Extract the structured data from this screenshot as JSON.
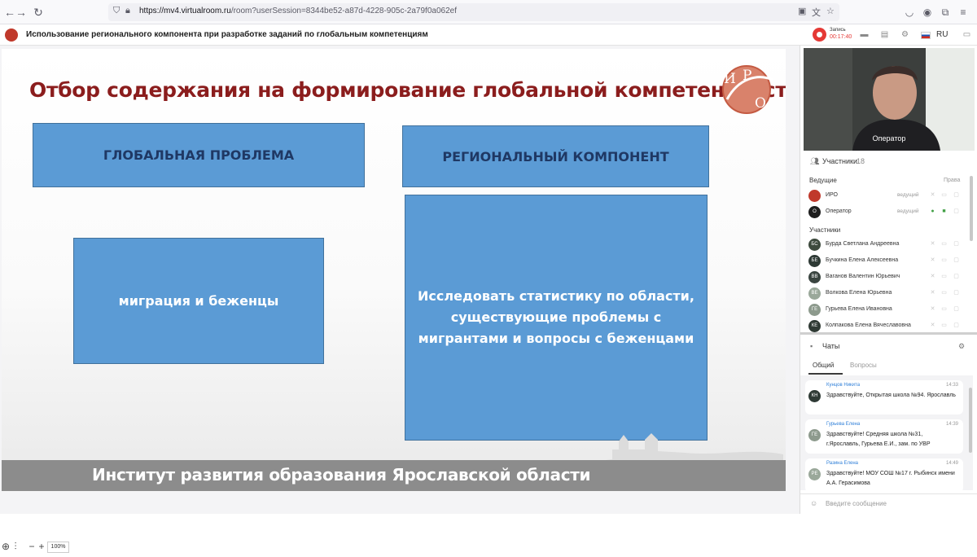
{
  "browser": {
    "url_host": "https://mv4.virtualroom.ru",
    "url_rest": "/room?userSession=8344be52-a87d-4228-905c-2a79f0a062ef",
    "back_glyph": "←",
    "forward_glyph": "→",
    "reload_glyph": "↻"
  },
  "app": {
    "title": "Использование регионального компонента при разработке заданий по глобальным компетенциям",
    "record_label": "Запись",
    "record_time": "00:17:40",
    "lang": "RU"
  },
  "slide": {
    "title": "Отбор содержания на формирование глобальной компетентности",
    "logo_letters": [
      "И",
      "Р",
      "О"
    ],
    "box_global_problem": "ГЛОБАЛЬНАЯ ПРОБЛЕМА",
    "box_regional_component": "РЕГИОНАЛЬНЫЙ КОМПОНЕНТ",
    "box_migration": "миграция и беженцы",
    "box_research": "Исследовать статистику по области, существующие проблемы с мигрантами и вопросы с беженцами",
    "footer": "Институт развития образования Ярославской области"
  },
  "zoom": {
    "minus": "−",
    "plus": "+",
    "value": "100%"
  },
  "video": {
    "label": "Оператор"
  },
  "participants": {
    "title": "Участники",
    "count": "18",
    "hosts_label": "Ведущие",
    "rights_label": "Права",
    "participants_label": "Участники",
    "hosts": [
      {
        "initials": "",
        "name": "ИРО",
        "role": "ведущий",
        "color": "#c0392b"
      },
      {
        "initials": "О",
        "name": "Оператор",
        "role": "ведущий",
        "color": "#1e1e1e"
      }
    ],
    "members": [
      {
        "initials": "БС",
        "name": "Бурда Светлана Андреевна",
        "color": "#3d4a3d"
      },
      {
        "initials": "БЕ",
        "name": "Бучкина Елена Алексеевна",
        "color": "#2e3a35"
      },
      {
        "initials": "ВВ",
        "name": "Ваганов Валентин Юрьевич",
        "color": "#3a4540"
      },
      {
        "initials": "ВЕ",
        "name": "Волкова Елена Юрьевна",
        "color": "#9aa89a"
      },
      {
        "initials": "ГЕ",
        "name": "Гурьева Елена Ивановна",
        "color": "#8d9a8d"
      },
      {
        "initials": "КЕ",
        "name": "Колпакова Елена Вячеславовна",
        "color": "#2f3a34"
      }
    ]
  },
  "chats": {
    "title": "Чаты",
    "tab_general": "Общий",
    "tab_questions": "Вопросы",
    "input_placeholder": "Введите сообщение",
    "messages": [
      {
        "initials": "КН",
        "author": "Кунцов Никита",
        "time": "14:33",
        "text": "Здравствуйте, Открытая школа №94. Ярославль",
        "color": "#2e3a35"
      },
      {
        "initials": "ГЕ",
        "author": "Гурьева Елена",
        "time": "14:39",
        "text": "Здравствуйте! Средняя школа №31, г.Ярославль, Гурьева Е.И., зам. по УВР",
        "color": "#8d9a8d"
      },
      {
        "initials": "РЕ",
        "author": "Разина Елена",
        "time": "14:49",
        "text": "Здравствуйте! МОУ СОШ №17 г. Рыбинск имени А.А. Герасимова",
        "color": "#9aa89a"
      }
    ]
  }
}
